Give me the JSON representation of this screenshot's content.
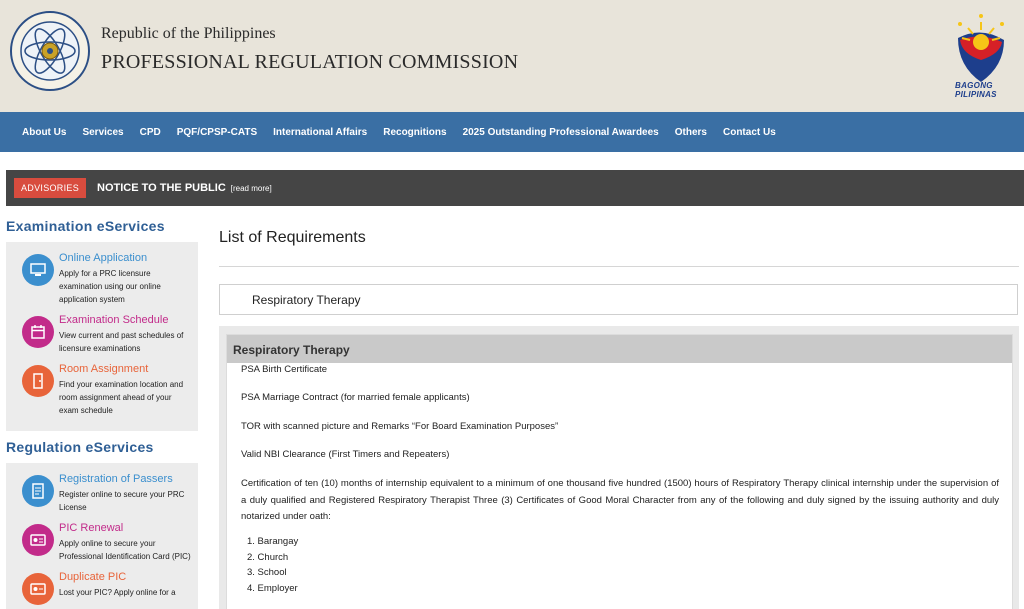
{
  "header": {
    "republic": "Republic of the Philippines",
    "agency": "PROFESSIONAL REGULATION COMMISSION",
    "bagong_pilipinas": "BAGONG PILIPINAS"
  },
  "nav": {
    "items": [
      "About Us",
      "Services",
      "CPD",
      "PQF/CPSP-CATS",
      "International Affairs",
      "Recognitions",
      "2025 Outstanding Professional Awardees",
      "Others",
      "Contact Us"
    ]
  },
  "advisory": {
    "badge": "ADVISORIES",
    "title": "NOTICE TO THE PUBLIC",
    "more": "[read more]"
  },
  "sidebar": {
    "exam_heading": "Examination eServices",
    "exam_items": [
      {
        "title": "Online Application",
        "desc": "Apply for a PRC licensure examination using our online application system",
        "color": "#3b8fce"
      },
      {
        "title": "Examination Schedule",
        "desc": "View current and past schedules of licensure examinations",
        "color": "#c22b8a"
      },
      {
        "title": "Room Assignment",
        "desc": "Find your examination location and room assignment ahead of your exam schedule",
        "color": "#e8643a"
      }
    ],
    "reg_heading": "Regulation eServices",
    "reg_items": [
      {
        "title": "Registration of Passers",
        "desc": "Register online to secure your PRC License",
        "color": "#3b8fce"
      },
      {
        "title": "PIC Renewal",
        "desc": "Apply online to secure your Professional Identification Card (PIC)",
        "color": "#c22b8a"
      },
      {
        "title": "Duplicate PIC",
        "desc": "Lost your PIC? Apply online for a",
        "color": "#e8643a"
      }
    ]
  },
  "main": {
    "title": "List of Requirements",
    "selected_profession": "Respiratory Therapy",
    "card_title": "Respiratory Therapy",
    "requirements": [
      "PSA Birth Certificate",
      "PSA Marriage Contract (for married female applicants)",
      "TOR with scanned picture and Remarks “For Board Examination Purposes”",
      "Valid NBI Clearance (First Timers and Repeaters)"
    ],
    "certification": "Certification of ten (10) months of internship equivalent to a minimum of one thousand five hundred (1500) hours of Respiratory Therapy clinical internship under the supervision of a duly qualified and Registered Respiratory Therapist Three (3) Certificates of Good Moral Character from any of the following and duly signed by the issuing authority and duly notarized under oath:",
    "issuers": [
      "1. Barangay",
      "2. Church",
      "3. School",
      "4. Employer"
    ]
  },
  "colors": {
    "nav_bg": "#3a6fa4",
    "advisory_bg": "#454545",
    "badge_bg": "#d84c3e",
    "heading_blue": "#2f5f95"
  }
}
